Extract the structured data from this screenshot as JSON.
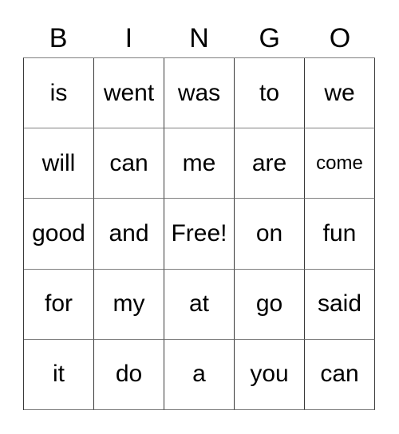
{
  "card": {
    "title": "BINGO",
    "header_letters": [
      "B",
      "I",
      "N",
      "G",
      "O"
    ],
    "free_space_label": "Free!",
    "colors": {
      "background": "#ffffff",
      "text": "#000000",
      "grid_line": "#3a3a3a"
    },
    "rows": [
      {
        "cells": [
          {
            "text": "is",
            "size": "normal"
          },
          {
            "text": "went",
            "size": "normal"
          },
          {
            "text": "was",
            "size": "normal"
          },
          {
            "text": "to",
            "size": "normal"
          },
          {
            "text": "we",
            "size": "normal"
          }
        ]
      },
      {
        "cells": [
          {
            "text": "will",
            "size": "normal"
          },
          {
            "text": "can",
            "size": "normal"
          },
          {
            "text": "me",
            "size": "normal"
          },
          {
            "text": "are",
            "size": "normal"
          },
          {
            "text": "come",
            "size": "small"
          }
        ]
      },
      {
        "cells": [
          {
            "text": "good",
            "size": "normal"
          },
          {
            "text": "and",
            "size": "normal"
          },
          {
            "text": "Free!",
            "size": "normal"
          },
          {
            "text": "on",
            "size": "normal"
          },
          {
            "text": "fun",
            "size": "normal"
          }
        ]
      },
      {
        "cells": [
          {
            "text": "for",
            "size": "normal"
          },
          {
            "text": "my",
            "size": "normal"
          },
          {
            "text": "at",
            "size": "normal"
          },
          {
            "text": "go",
            "size": "normal"
          },
          {
            "text": "said",
            "size": "normal"
          }
        ]
      },
      {
        "cells": [
          {
            "text": "it",
            "size": "normal"
          },
          {
            "text": "do",
            "size": "normal"
          },
          {
            "text": "a",
            "size": "normal"
          },
          {
            "text": "you",
            "size": "normal"
          },
          {
            "text": "can",
            "size": "normal"
          }
        ]
      }
    ]
  }
}
